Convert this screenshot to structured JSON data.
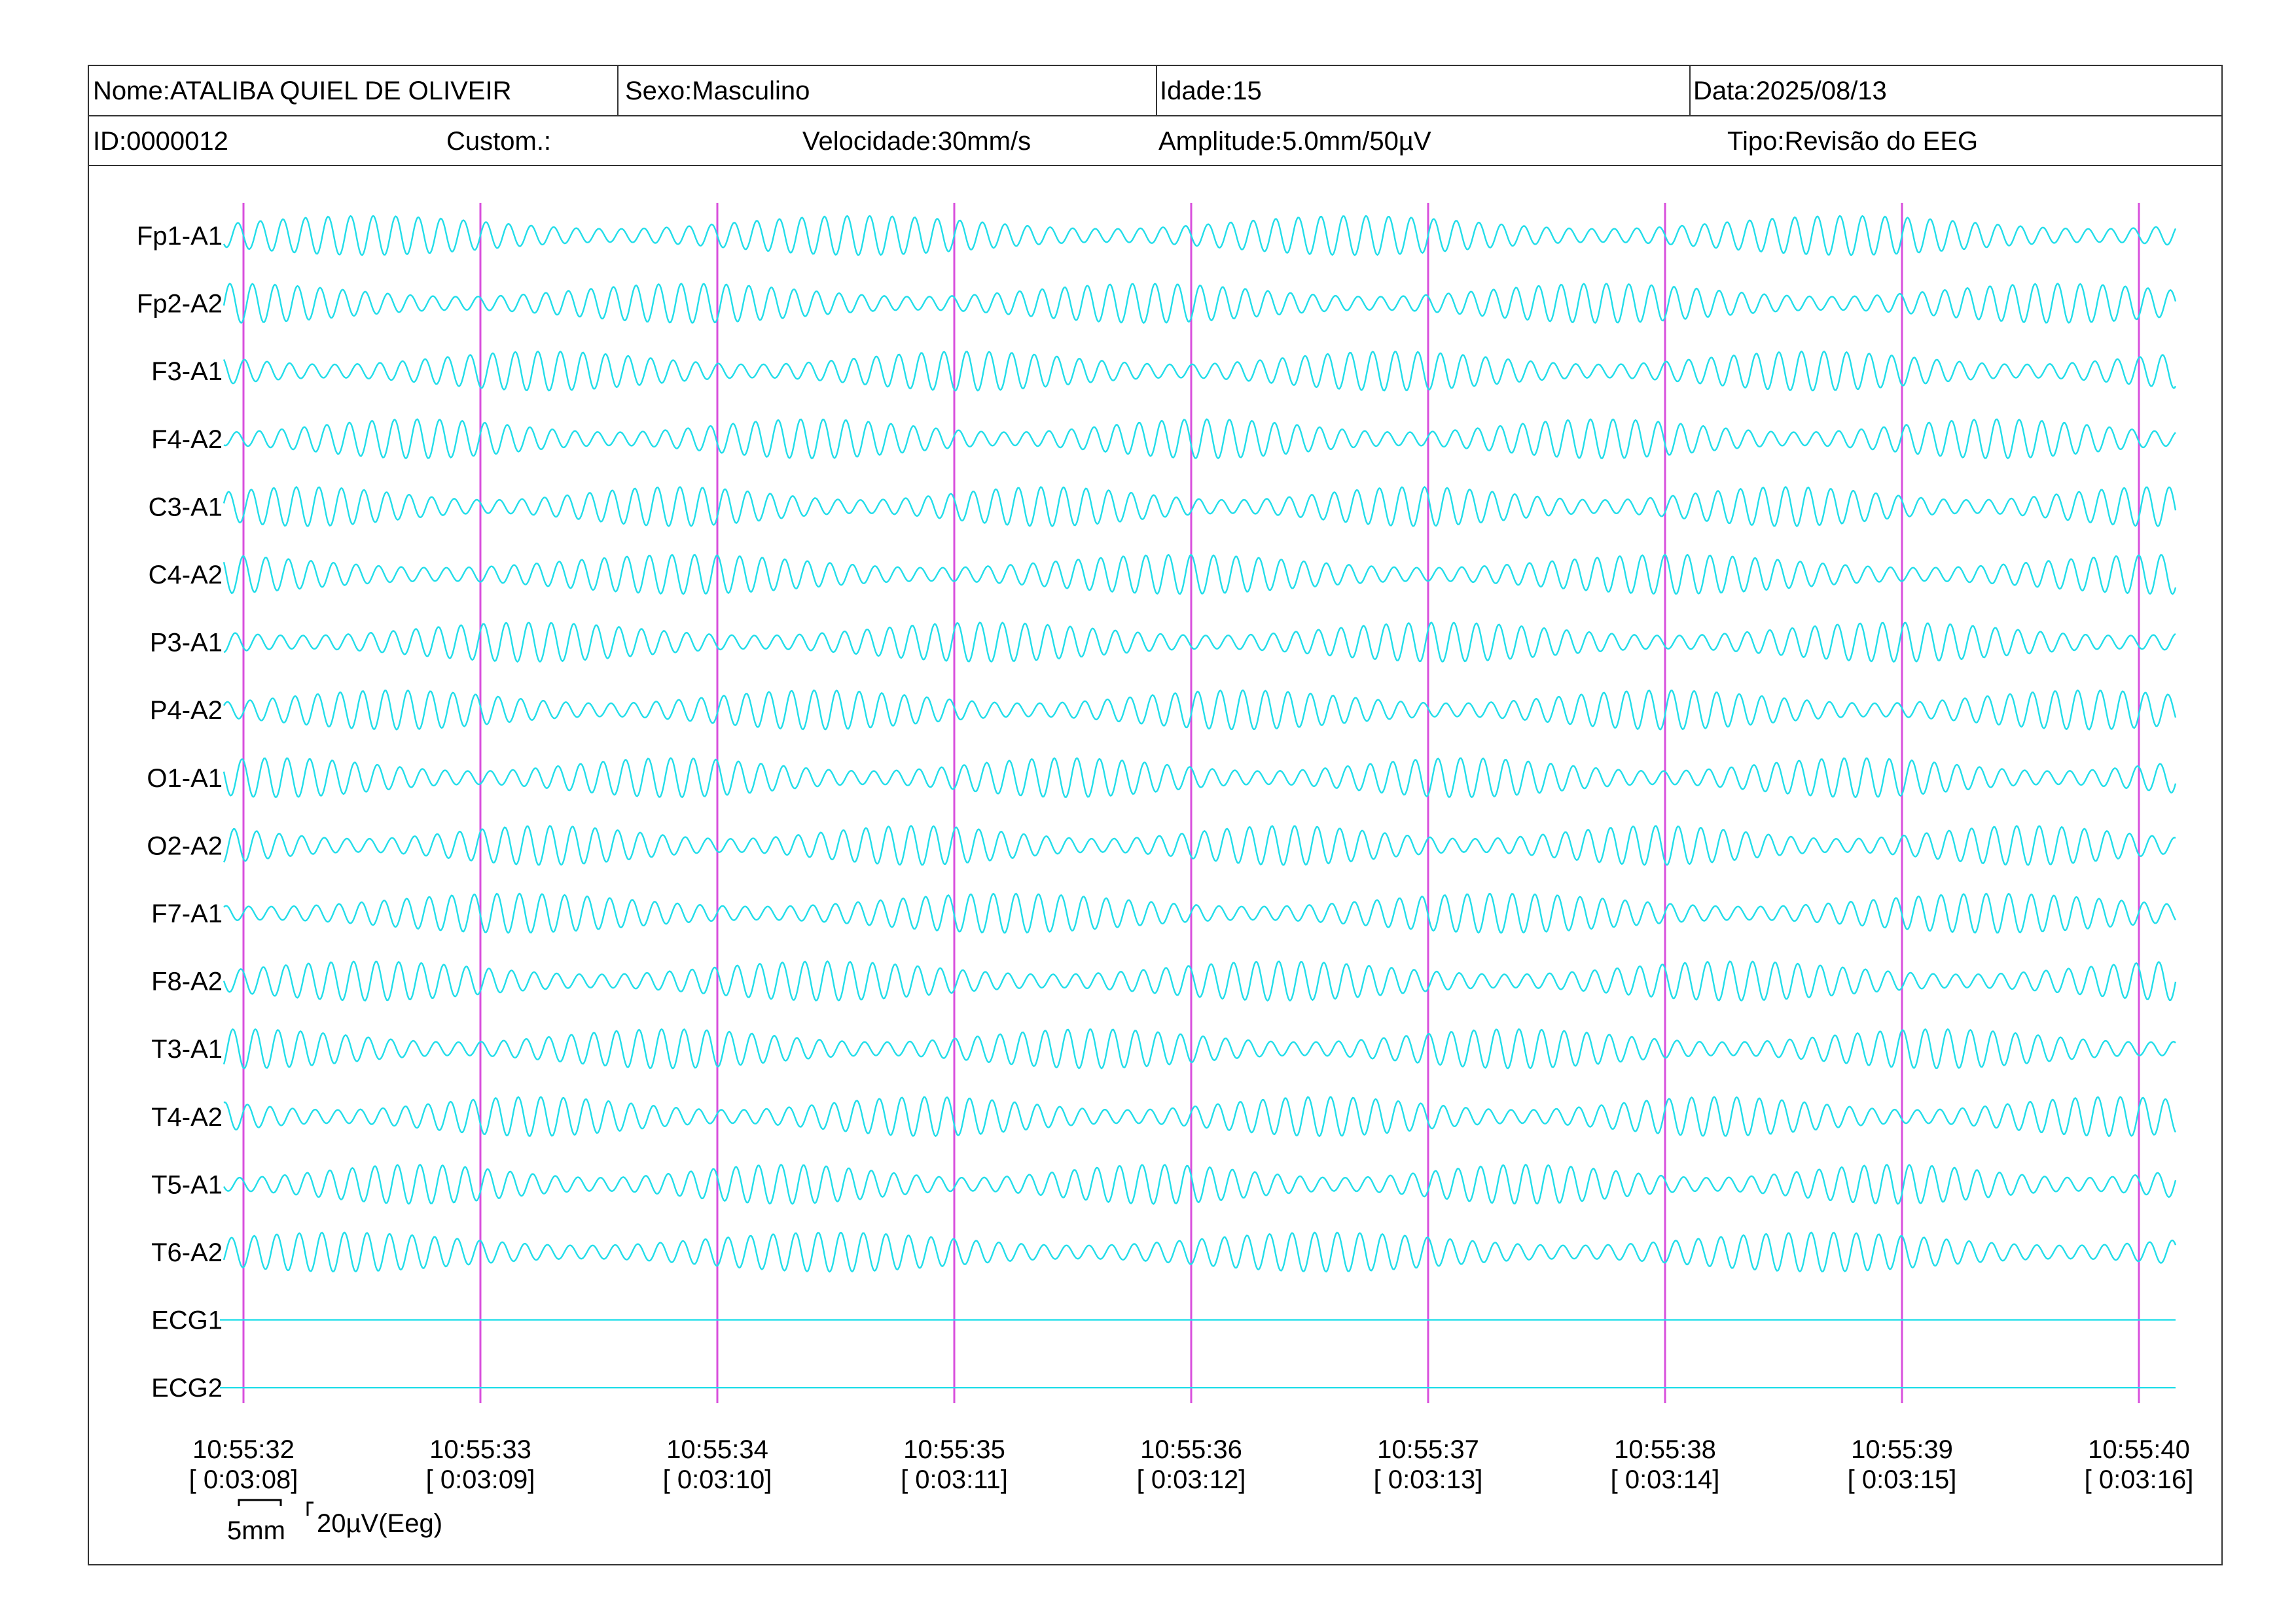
{
  "header": {
    "row1": {
      "name": "Nome:ATALIBA QUIEL DE OLIVEIR",
      "sex": "Sexo:Masculino",
      "age": "Idade:15",
      "date": "Data:2025/08/13"
    },
    "row2": {
      "id": "ID:0000012",
      "custom": "Custom.:",
      "speed": "Velocidade:30mm/s",
      "amplitude": "Amplitude:5.0mm/50µV",
      "type": "Tipo:Revisão do EEG"
    }
  },
  "colors": {
    "trace": "#22dde9",
    "marker": "#d84fdc",
    "border": "#333333",
    "text": "#000000"
  },
  "scale": {
    "time_label": "5mm",
    "amp_label": "20µV(Eeg)"
  },
  "chart_data": {
    "type": "line",
    "title": "",
    "xlabel": "",
    "ylabel": "",
    "grid": false,
    "legend": "none",
    "channels": [
      "Fp1-A1",
      "Fp2-A2",
      "F3-A1",
      "F4-A2",
      "C3-A1",
      "C4-A2",
      "P3-A1",
      "P4-A2",
      "O1-A1",
      "O2-A2",
      "F7-A1",
      "F8-A2",
      "T3-A1",
      "T4-A2",
      "T5-A1",
      "T6-A2",
      "ECG1",
      "ECG2"
    ],
    "x_range_seconds": [
      0,
      8.07
    ],
    "dominant_frequency_hz": 10.5,
    "ecg_flat": true,
    "time_ticks": [
      {
        "clock": "10:55:32",
        "elapsed": "[ 0:03:08]",
        "t": 0
      },
      {
        "clock": "10:55:33",
        "elapsed": "[ 0:03:09]",
        "t": 1
      },
      {
        "clock": "10:55:34",
        "elapsed": "[ 0:03:10]",
        "t": 2
      },
      {
        "clock": "10:55:35",
        "elapsed": "[ 0:03:11]",
        "t": 3
      },
      {
        "clock": "10:55:36",
        "elapsed": "[ 0:03:12]",
        "t": 4
      },
      {
        "clock": "10:55:37",
        "elapsed": "[ 0:03:13]",
        "t": 5
      },
      {
        "clock": "10:55:38",
        "elapsed": "[ 0:03:14]",
        "t": 6
      },
      {
        "clock": "10:55:39",
        "elapsed": "[ 0:03:15]",
        "t": 7
      },
      {
        "clock": "10:55:40",
        "elapsed": "[ 0:03:16]",
        "t": 8
      }
    ]
  }
}
